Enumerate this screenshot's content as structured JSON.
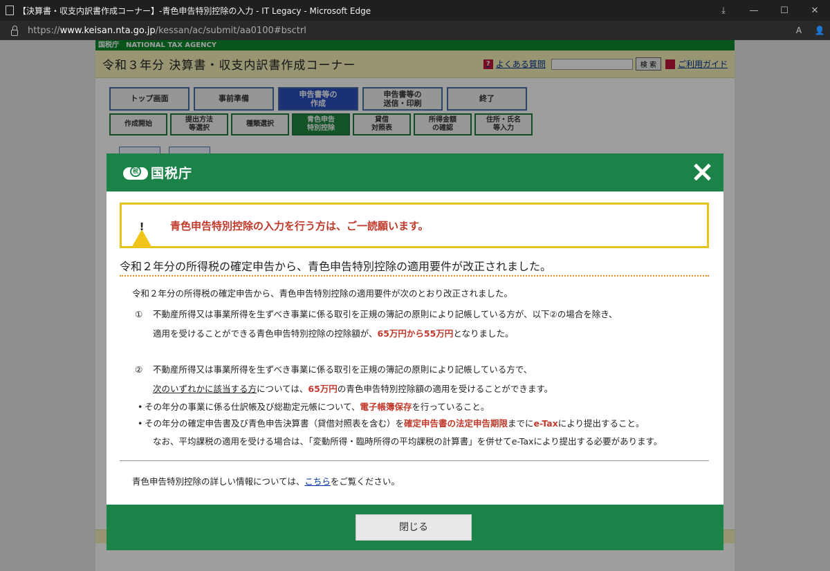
{
  "window": {
    "title": "【決算書・収支内訳書作成コーナー】-青色申告特別控除の入力 - IT Legacy - Microsoft Edge",
    "url_scheme": "https://",
    "url_host": "www.keisan.nta.go.jp",
    "url_path": "/kessan/ac/submit/aa0100#bsctrl",
    "controls": {
      "minimize": "—",
      "maximize": "☐",
      "close": "✕"
    },
    "tools": {
      "read_aloud": "A",
      "profile": "👤"
    }
  },
  "page": {
    "agency_bar": "国税庁　NATIONAL TAX AGENCY",
    "title": "令和３年分 決算書・収支内訳書作成コーナー",
    "faq_label": "よくある質問",
    "search_button": "検 索",
    "guide_label": "ご利用ガイド",
    "main_steps": [
      {
        "label": "トップ画面"
      },
      {
        "label": "事前準備"
      },
      {
        "label": "申告書等の\n作成",
        "active": true
      },
      {
        "label": "申告書等の\n送信・印刷"
      },
      {
        "label": "終了"
      }
    ],
    "sub_steps": [
      {
        "label": "作成開始"
      },
      {
        "label": "提出方法\n等選択"
      },
      {
        "label": "種類選択"
      },
      {
        "label": "青色申告\n特別控除",
        "active": true
      },
      {
        "label": "貸借\n対照表"
      },
      {
        "label": "所得金額\nの確認"
      },
      {
        "label": "住所・氏名\n等入力"
      }
    ]
  },
  "modal": {
    "logo_text": "国税庁",
    "logo_mark_text": "税",
    "close_icon": "close-icon",
    "warning": "青色申告特別控除の入力を行う方は、ご一読願います。",
    "heading": "令和２年分の所得税の確定申告から、青色申告特別控除の適用要件が改正されました。",
    "intro": "令和２年分の所得税の確定申告から、青色申告特別控除の適用要件が次のとおり改正されました。",
    "item1": {
      "num": "①",
      "line1": "不動産所得又は事業所得を生ずべき事業に係る取引を正規の簿記の原則により記帳している方が、以下②の場合を除き、",
      "line2_pre": "適用を受けることができる青色申告特別控除の控除額が、",
      "line2_red": "65万円から55万円",
      "line2_post": "となりました。"
    },
    "item2": {
      "num": "②",
      "line1": "不動産所得又は事業所得を生ずべき事業に係る取引を正規の簿記の原則により記帳している方で、",
      "line2_ul": "次のいずれかに該当する方",
      "line2_mid": "については、",
      "line2_red": "65万円",
      "line2_post": "の青色申告特別控除額の適用を受けることができます。"
    },
    "bullet1": {
      "pre": "その年分の事業に係る仕訳帳及び総勘定元帳について、",
      "red": "電子帳簿保存",
      "post": "を行っていること。"
    },
    "bullet2": {
      "pre": "その年分の確定申告書及び青色申告決算書（貸借対照表を含む）を",
      "red1": "確定申告書の法定申告期限",
      "mid": "までに",
      "red2": "e-Tax",
      "post": "により提出すること。"
    },
    "note": "なお、平均課税の適用を受ける場合は、「変動所得・臨時所得の平均課税の計算書」を併せてe-Taxにより提出する必要があります。",
    "more_pre": "青色申告特別控除の詳しい情報については、",
    "more_link": "こちら",
    "more_post": "をご覧ください。",
    "close_button": "閉じる"
  }
}
